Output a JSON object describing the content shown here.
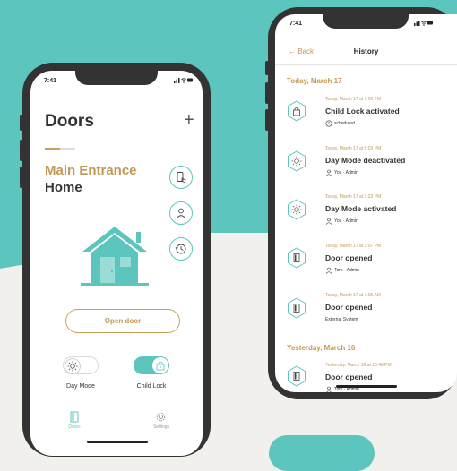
{
  "colors": {
    "teal": "#5cc5be",
    "gold": "#c39a55",
    "dark": "#333333",
    "background": "#f2f0ec"
  },
  "phone_main": {
    "status": {
      "time": "7:41",
      "icons": "signal-wifi-battery"
    },
    "title": "Doors",
    "add_icon": "plus-icon",
    "location": {
      "name": "Main Entrance",
      "sub": "Home"
    },
    "side_actions": [
      {
        "icon": "door-remote-icon"
      },
      {
        "icon": "person-icon"
      },
      {
        "icon": "history-clock-icon"
      }
    ],
    "illustration": "house-icon",
    "open_door_label": "Open door",
    "toggles": [
      {
        "label": "Day Mode",
        "on": false,
        "icon": "sun-icon"
      },
      {
        "label": "Child Lock",
        "on": true,
        "icon": "lock-icon"
      }
    ],
    "nav": [
      {
        "label": "Doors",
        "active": true,
        "icon": "door-icon"
      },
      {
        "label": "Settings",
        "active": false,
        "icon": "gear-icon"
      }
    ]
  },
  "phone_history": {
    "status": {
      "time": "7:41",
      "icons": "signal-wifi-battery"
    },
    "back_label": "Back",
    "title": "History",
    "sections": [
      {
        "label": "Today, March 17",
        "events": [
          {
            "time": "Today, March 17 at 7:00 PM",
            "title": "Child Lock activated",
            "meta": "scheduled",
            "meta_icon": "clock-icon",
            "icon": "lock-icon"
          },
          {
            "time": "Today, March 17 at 5:03 PM",
            "title": "Day Mode deactivated",
            "meta": "You · Admin",
            "meta_icon": "user-icon",
            "icon": "sun-icon"
          },
          {
            "time": "Today, March 17 at 3:23 PM",
            "title": "Day Mode activated",
            "meta": "You · Admin",
            "meta_icon": "user-icon",
            "icon": "sun-icon"
          },
          {
            "time": "Today, March 17 at 3:07 PM",
            "title": "Door opened",
            "meta": "Tom · Admin",
            "meta_icon": "user-icon",
            "icon": "door-icon"
          },
          {
            "time": "Today, March 17 at 7:05 AM",
            "title": "Door opened",
            "meta": "External System",
            "meta_icon": "",
            "icon": "door-icon"
          }
        ]
      },
      {
        "label": "Yesterday, March 16",
        "events": [
          {
            "time": "Yesterday, March 16 at 10:48 PM",
            "title": "Door opened",
            "meta": "Tom · Admin",
            "meta_icon": "user-icon",
            "icon": "door-icon"
          }
        ]
      }
    ]
  }
}
